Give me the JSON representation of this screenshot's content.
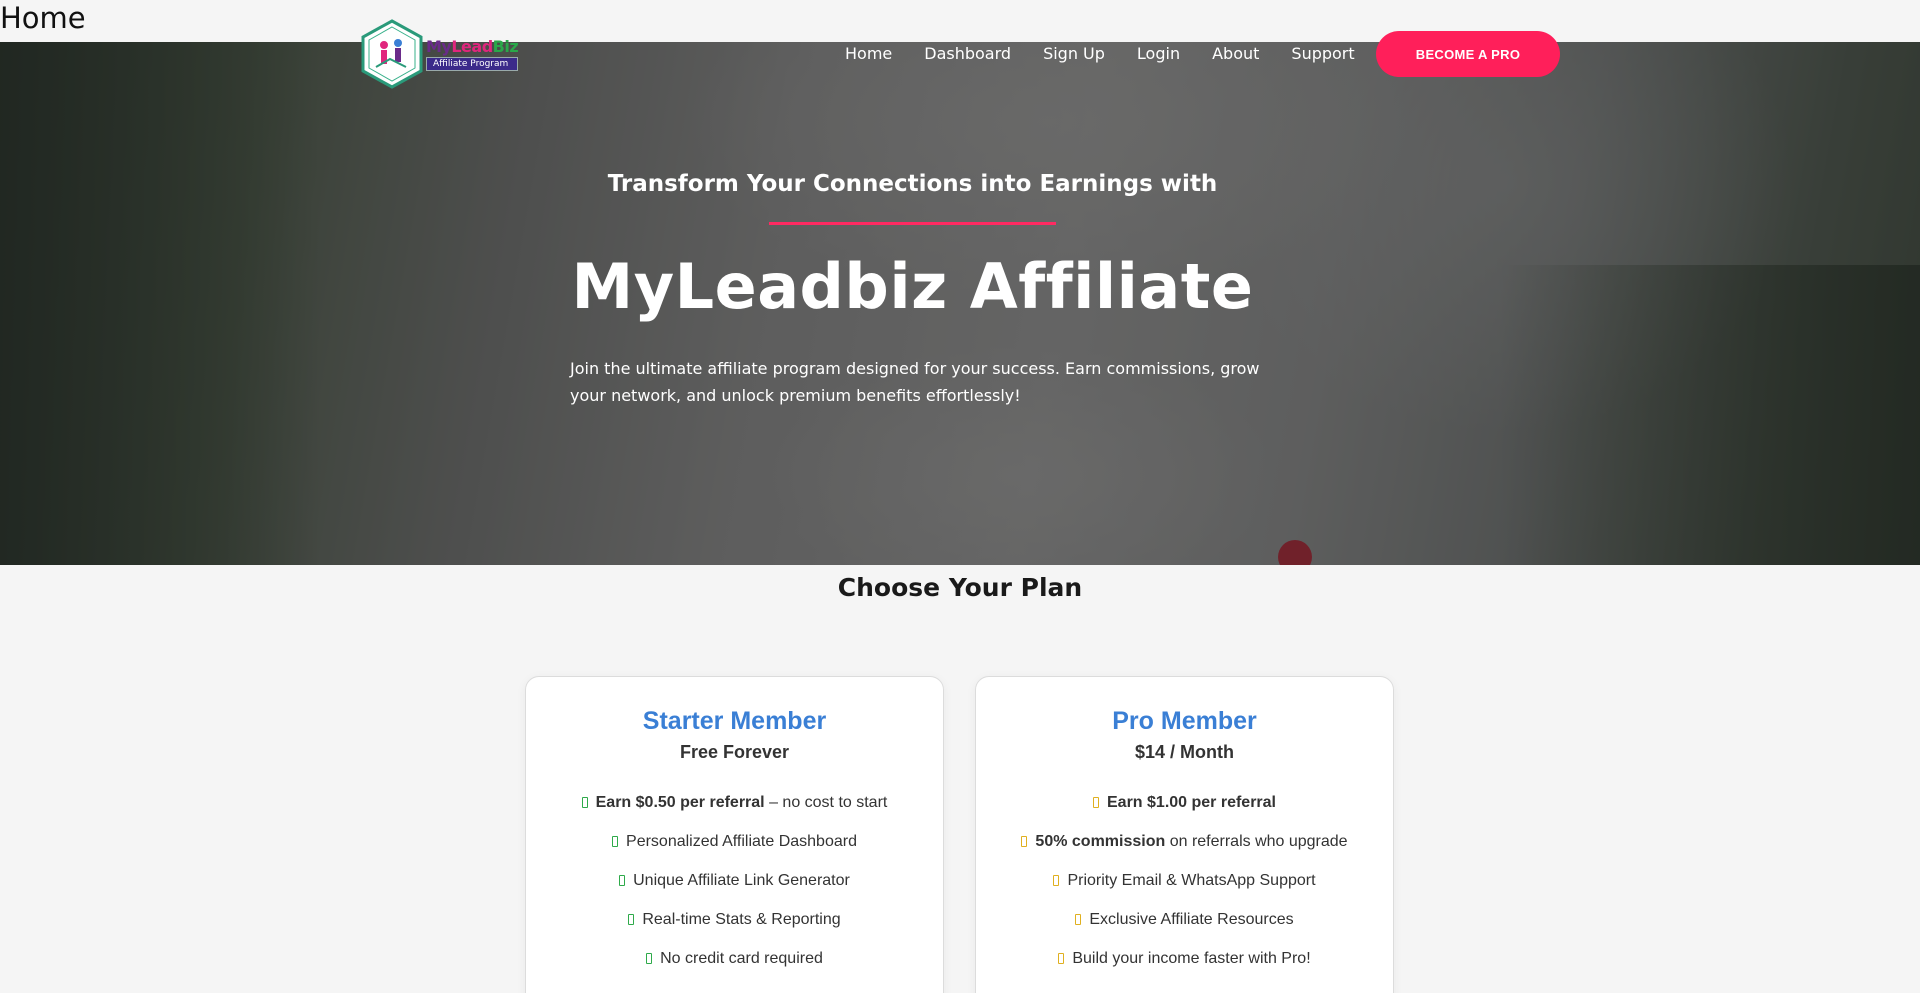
{
  "page_label": "Home",
  "logo": {
    "name_part1": "My",
    "name_part2": "Lead",
    "name_part3": "Biz",
    "subtitle": "Affiliate Program"
  },
  "nav": {
    "items": [
      "Home",
      "Dashboard",
      "Sign Up",
      "Login",
      "About",
      "Support"
    ],
    "cta_label": "BECOME A PRO"
  },
  "hero": {
    "kicker": "Transform Your Connections into Earnings with",
    "title": "MyLeadbiz Affiliate",
    "description": "Join the ultimate affiliate program designed for your success. Earn commissions, grow your network, and unlock premium benefits effortlessly!"
  },
  "plans": {
    "heading": "Choose Your Plan",
    "starter": {
      "title": "Starter Member",
      "price": "Free Forever",
      "features": [
        {
          "bold": "Earn $0.50 per referral",
          "rest": " – no cost to start"
        },
        {
          "bold": "",
          "rest": "Personalized Affiliate Dashboard"
        },
        {
          "bold": "",
          "rest": "Unique Affiliate Link Generator"
        },
        {
          "bold": "",
          "rest": "Real-time Stats & Reporting"
        },
        {
          "bold": "",
          "rest": "No credit card required"
        }
      ]
    },
    "pro": {
      "title": "Pro Member",
      "price": "$14 / Month",
      "features": [
        {
          "bold": "Earn $1.00 per referral",
          "rest": ""
        },
        {
          "bold": "50% commission",
          "rest": " on referrals who upgrade"
        },
        {
          "bold": "",
          "rest": "Priority Email & WhatsApp Support"
        },
        {
          "bold": "",
          "rest": "Exclusive Affiliate Resources"
        },
        {
          "bold": "",
          "rest": "Build your income faster with Pro!"
        }
      ]
    }
  },
  "colors": {
    "accent": "#ff1f5a",
    "plan_title": "#3a7fd5",
    "starter_check": "#2eaa4a",
    "pro_check": "#e0b020"
  },
  "icons": {
    "feature_bullet": "check-icon"
  }
}
